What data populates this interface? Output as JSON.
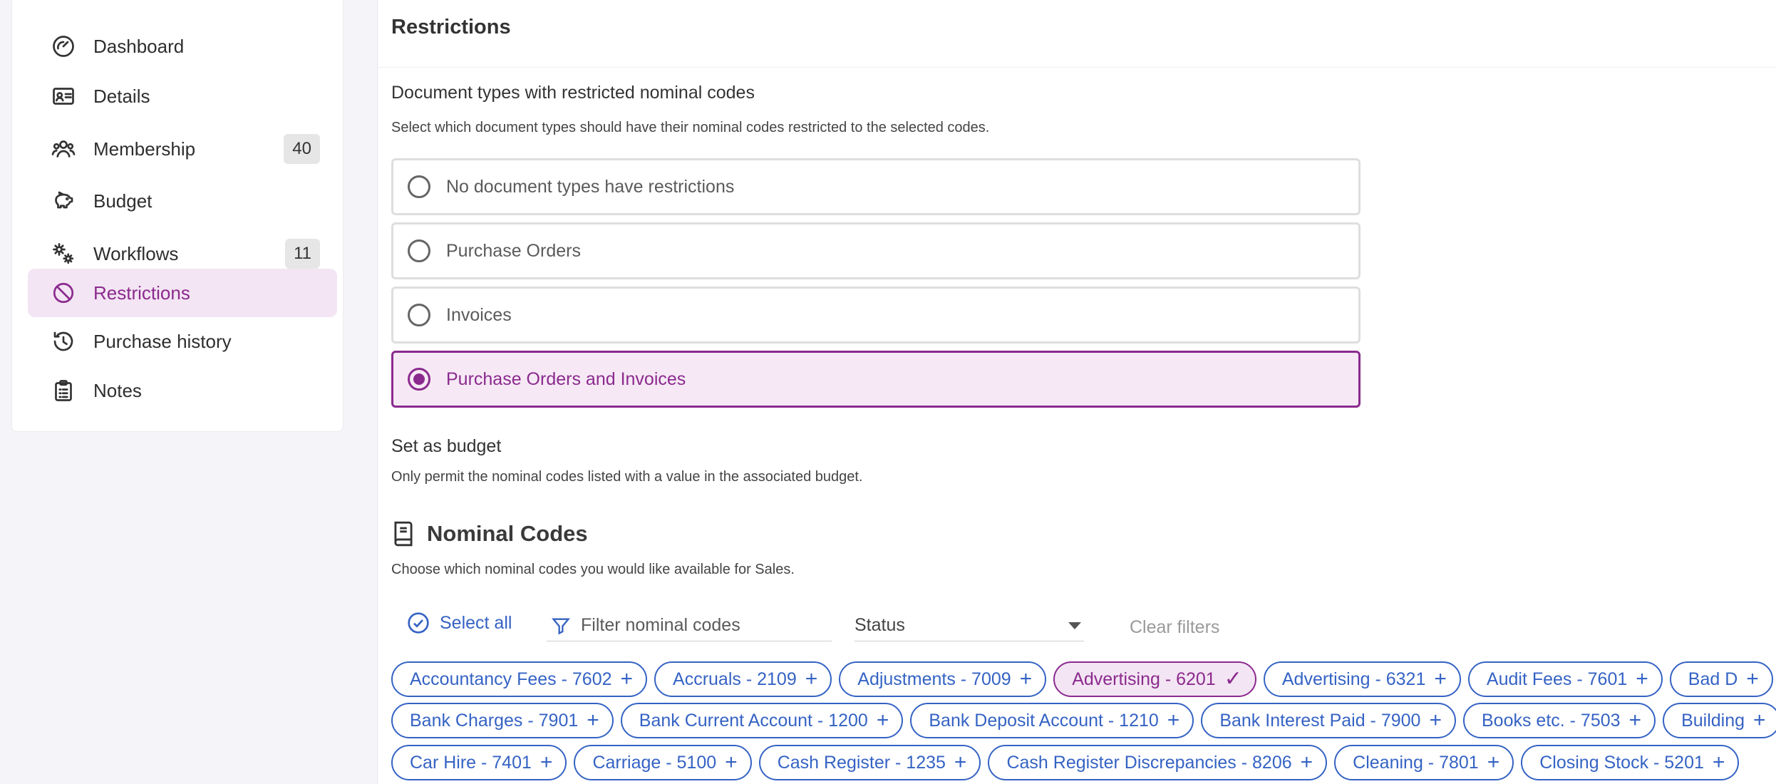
{
  "sidebar": {
    "items": [
      {
        "label": "Dashboard",
        "icon": "dashboard-icon"
      },
      {
        "label": "Details",
        "icon": "id-card-icon"
      },
      {
        "label": "Membership",
        "icon": "users-icon",
        "badge": "40"
      },
      {
        "label": "Budget",
        "icon": "piggy-bank-icon"
      },
      {
        "label": "Workflows",
        "icon": "gears-icon",
        "badge": "11"
      },
      {
        "label": "Restrictions",
        "icon": "ban-icon",
        "active": true
      },
      {
        "label": "Purchase history",
        "icon": "history-icon"
      },
      {
        "label": "Notes",
        "icon": "clipboard-icon"
      }
    ]
  },
  "main": {
    "title": "Restrictions",
    "doc_types": {
      "title": "Document types with restricted nominal codes",
      "description": "Select which document types should have their nominal codes restricted to the selected codes.",
      "options": [
        {
          "label": "No document types have restrictions",
          "selected": false
        },
        {
          "label": "Purchase Orders",
          "selected": false
        },
        {
          "label": "Invoices",
          "selected": false
        },
        {
          "label": "Purchase Orders and Invoices",
          "selected": true
        }
      ]
    },
    "budget": {
      "title": "Set as budget",
      "description": "Only permit the nominal codes listed with a value in the associated budget."
    },
    "nominal": {
      "title": "Nominal Codes",
      "description": "Choose which nominal codes you would like available for Sales.",
      "select_all_label": "Select all",
      "filter_placeholder": "Filter nominal codes",
      "status_label": "Status",
      "clear_filters_label": "Clear filters",
      "chip_rows": [
        [
          {
            "label": "Accountancy Fees - 7602",
            "selected": false
          },
          {
            "label": "Accruals - 2109",
            "selected": false
          },
          {
            "label": "Adjustments - 7009",
            "selected": false
          },
          {
            "label": "Advertising - 6201",
            "selected": true
          },
          {
            "label": "Advertising - 6321",
            "selected": false
          },
          {
            "label": "Audit Fees - 7601",
            "selected": false
          },
          {
            "label": "Bad D",
            "selected": false
          }
        ],
        [
          {
            "label": "Bank Charges - 7901",
            "selected": false
          },
          {
            "label": "Bank Current Account - 1200",
            "selected": false
          },
          {
            "label": "Bank Deposit Account - 1210",
            "selected": false
          },
          {
            "label": "Bank Interest Paid - 7900",
            "selected": false
          },
          {
            "label": "Books etc. - 7503",
            "selected": false
          },
          {
            "label": "Building",
            "selected": false
          }
        ],
        [
          {
            "label": "Car Hire - 7401",
            "selected": false
          },
          {
            "label": "Carriage - 5100",
            "selected": false
          },
          {
            "label": "Cash Register - 1235",
            "selected": false
          },
          {
            "label": "Cash Register Discrepancies - 8206",
            "selected": false
          },
          {
            "label": "Cleaning - 7801",
            "selected": false
          },
          {
            "label": "Closing Stock - 5201",
            "selected": false
          }
        ]
      ]
    }
  },
  "colors": {
    "accent": "#8b2a8e",
    "accent_bg": "#f3e5f3",
    "link": "#3563c4"
  }
}
